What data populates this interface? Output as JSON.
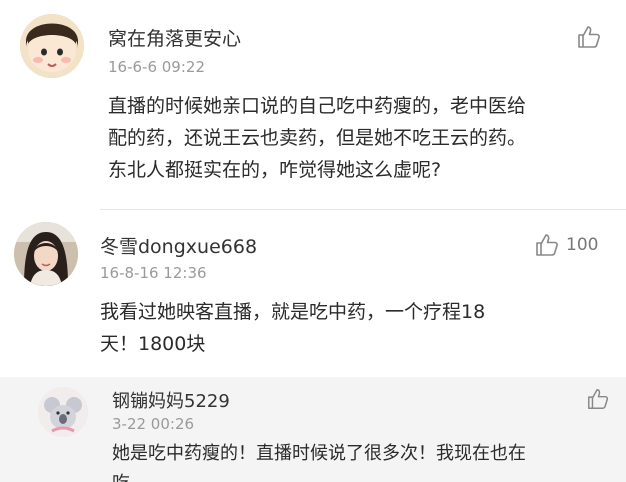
{
  "comments": [
    {
      "username": "窝在角落更安心",
      "timestamp": "16-6-6 09:22",
      "likes": "",
      "lines": [
        "直播的时候她亲口说的自己吃中药瘦的，老中医给",
        "配的药，还说王云也卖药，但是她不吃王云的药。",
        "东北人都挺实在的，咋觉得她这么虚呢?"
      ]
    },
    {
      "username": "冬雪dongxue668",
      "timestamp": "16-8-16 12:36",
      "likes": "100",
      "lines": [
        "我看过她映客直播，就是吃中药，一个疗程18",
        "天！1800块"
      ]
    },
    {
      "username": "钢镚妈妈5229",
      "timestamp": "3-22 00:26",
      "likes": "",
      "lines": [
        "她是吃中药瘦的！直播时候说了很多次！我现在也在",
        "吃"
      ]
    }
  ],
  "icons": {
    "like": "thumbs-up-icon"
  },
  "colors": {
    "accent_text": "#333333",
    "muted": "#9a9a9a",
    "reply_bg": "#f4f4f4"
  }
}
